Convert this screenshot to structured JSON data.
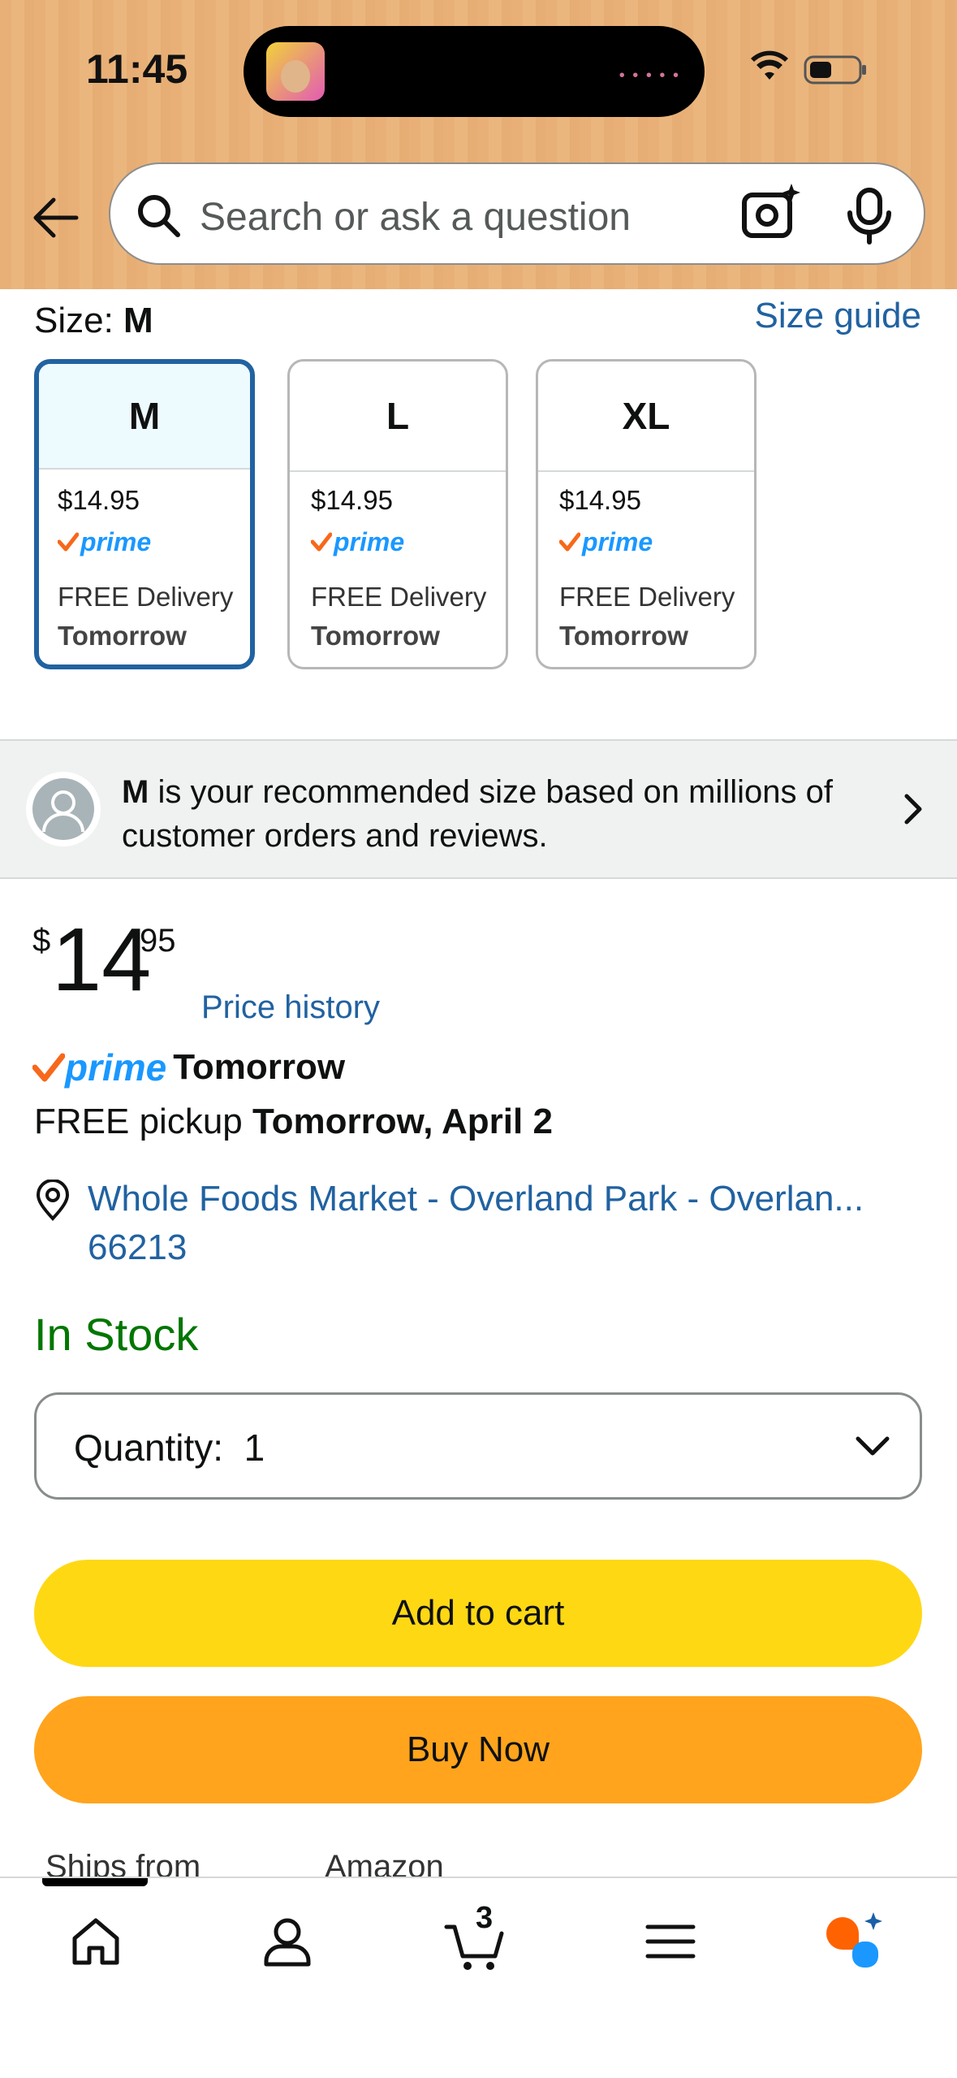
{
  "status_bar": {
    "time": "11:45"
  },
  "header": {
    "search_placeholder": "Search or ask a question"
  },
  "size": {
    "label": "Size: ",
    "selected": "M",
    "guide_link": "Size guide",
    "options": [
      {
        "size": "M",
        "price": "$14.95",
        "prime": "prime",
        "delivery": "FREE Delivery",
        "when": "Tomorrow",
        "selected": true
      },
      {
        "size": "L",
        "price": "$14.95",
        "prime": "prime",
        "delivery": "FREE Delivery",
        "when": "Tomorrow",
        "selected": false
      },
      {
        "size": "XL",
        "price": "$14.95",
        "prime": "prime",
        "delivery": "FREE Delivery",
        "when": "Tomorrow",
        "selected": false
      }
    ]
  },
  "recommendation": {
    "size": "M",
    "text": " is your recommended size based on millions of customer orders and reviews."
  },
  "price": {
    "symbol": "$",
    "whole": "14",
    "fraction": "95",
    "history_link": "Price history"
  },
  "delivery": {
    "prime": "prime",
    "prime_when": "Tomorrow",
    "pickup_prefix": "FREE pickup ",
    "pickup_date": "Tomorrow, April 2",
    "location": "Whole Foods Market - Overland Park - Overlan... 66213"
  },
  "stock": {
    "status": "In Stock"
  },
  "quantity": {
    "label": "Quantity:",
    "value": "1"
  },
  "buttons": {
    "add_to_cart": "Add to cart",
    "buy_now": "Buy Now"
  },
  "ships": {
    "label": "Ships from",
    "value": "Amazon"
  },
  "bottom_nav": {
    "cart_count": "3",
    "items": [
      "home-icon",
      "account-icon",
      "cart-icon",
      "menu-icon",
      "rufus-icon"
    ]
  },
  "colors": {
    "link": "#2162a1",
    "prime": "#1a98ff",
    "in_stock": "#007600",
    "add_to_cart": "#ffd814",
    "buy_now": "#ffa41c"
  }
}
